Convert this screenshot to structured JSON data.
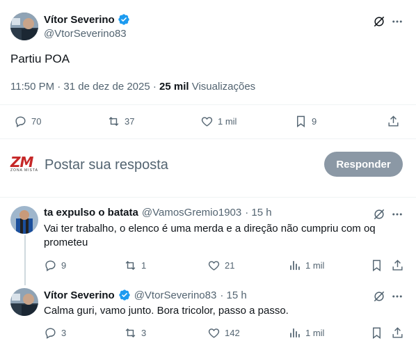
{
  "main_tweet": {
    "author_name": "Vítor Severino",
    "author_handle": "@VtorSeverino83",
    "text": "Partiu POA",
    "time": "11:50 PM · 31 de dez de 2025 · ",
    "views_count": "25 mil",
    "views_label": " Visualizações",
    "actions": {
      "replies": "70",
      "reposts": "37",
      "likes": "1 mil",
      "bookmarks": "9"
    }
  },
  "composer": {
    "logo_text": "ZM",
    "logo_subtext": "ZONA MISTA",
    "placeholder": "Postar sua resposta",
    "button_label": "Responder"
  },
  "replies": [
    {
      "author_name": "ta expulso o batata",
      "author_handle": "@VamosGremio1903",
      "age": "· 15 h",
      "text": "Vai ter trabalho, o elenco é uma merda e a direção não cumpriu com oq prometeu",
      "actions": {
        "replies": "9",
        "reposts": "1",
        "likes": "21",
        "views": "1 mil"
      }
    },
    {
      "author_name": "Vítor Severino",
      "author_handle": "@VtorSeverino83",
      "age": "· 15 h",
      "text": "Calma guri, vamo junto. Bora tricolor, passo a passo.",
      "actions": {
        "replies": "3",
        "reposts": "3",
        "likes": "142",
        "views": "1 mil"
      }
    }
  ],
  "colors": {
    "accent": "#1d9bf0",
    "muted": "#536471",
    "button": "#8b98a5",
    "divider": "#eff3f4"
  }
}
